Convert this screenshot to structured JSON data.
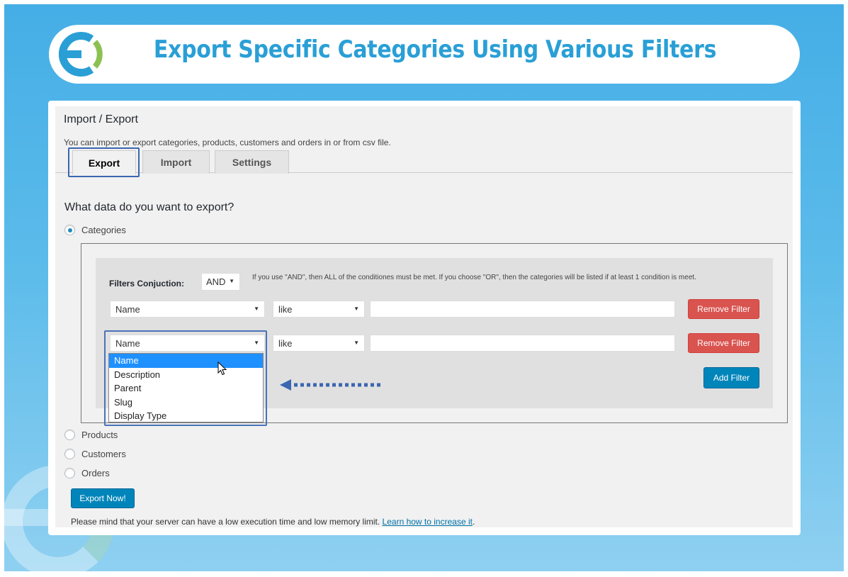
{
  "banner": {
    "title": "Export Specific Categories Using Various Filters"
  },
  "page": {
    "title": "Import / Export",
    "description": "You can import or export categories, products, customers and orders in or from csv file."
  },
  "tabs": [
    {
      "label": "Export",
      "active": true
    },
    {
      "label": "Import",
      "active": false
    },
    {
      "label": "Settings",
      "active": false
    }
  ],
  "question": "What data do you want to export?",
  "options": {
    "categories": "Categories",
    "products": "Products",
    "customers": "Customers",
    "orders": "Orders"
  },
  "filters": {
    "conjunction_label": "Filters Conjuction:",
    "conjunction_value": "AND",
    "hint": "If you use \"AND\", then ALL of the conditiones must be met. If you choose \"OR\", then the categories will be listed if at least 1 condition is meet.",
    "rows": [
      {
        "field": "Name",
        "operator": "like",
        "value": "",
        "remove_label": "Remove Filter"
      },
      {
        "field": "Name",
        "operator": "like",
        "value": "",
        "remove_label": "Remove Filter"
      }
    ],
    "add_label": "Add Filter",
    "field_options": [
      "Name",
      "Description",
      "Parent",
      "Slug",
      "Display Type"
    ],
    "selected_option": "Name"
  },
  "export_button": "Export Now!",
  "note": {
    "text": "Please mind that your server can have a low execution time and low memory limit.",
    "link": "Learn how to increase it",
    "suffix": "."
  },
  "colors": {
    "accent_blue": "#0085ba",
    "remove_red": "#d9534f",
    "banner_text": "#2a9fd6",
    "highlight": "#3b66b0"
  }
}
